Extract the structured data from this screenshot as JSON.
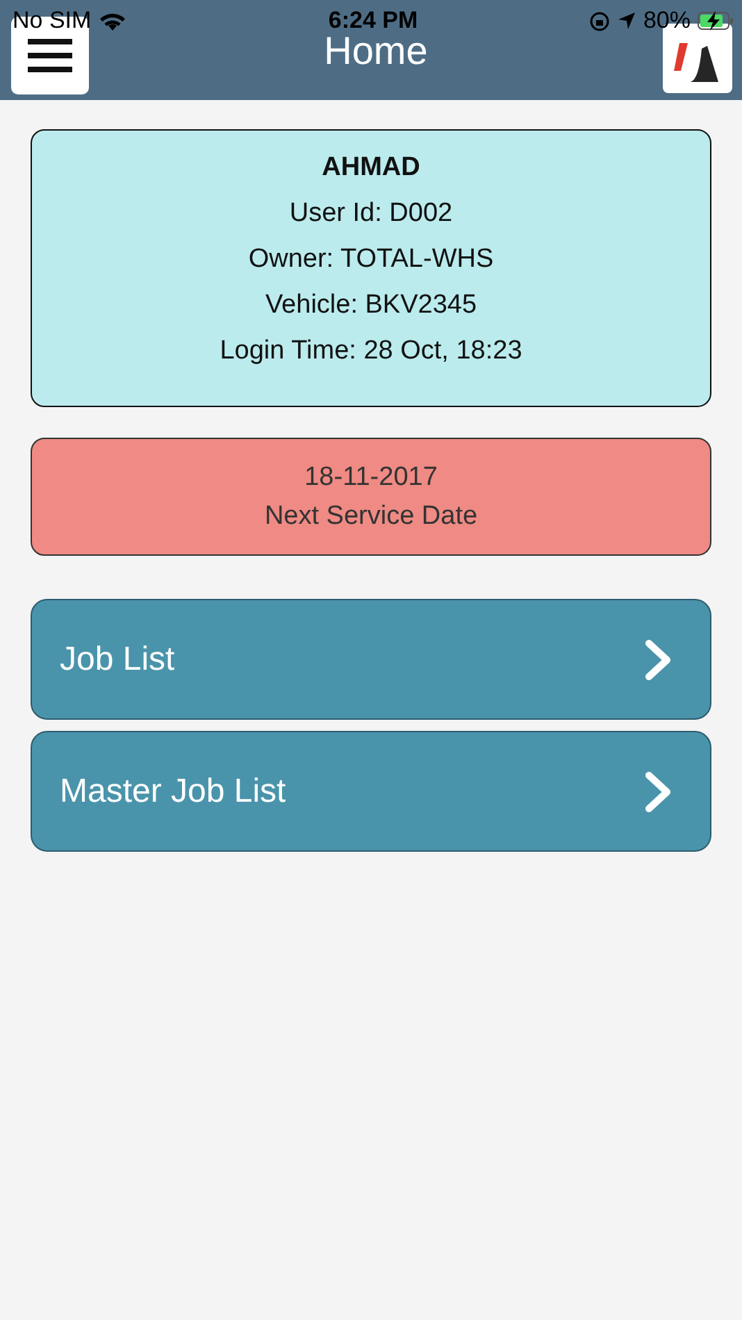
{
  "status_bar": {
    "carrier": "No SIM",
    "time": "6:24 PM",
    "battery": "80%"
  },
  "header": {
    "title": "Home"
  },
  "user_card": {
    "name": "AHMAD",
    "lines": [
      "User Id: D002",
      "Owner: TOTAL-WHS",
      "Vehicle: BKV2345",
      "Login Time: 28 Oct, 18:23"
    ]
  },
  "service_card": {
    "date": "18-11-2017",
    "label": "Next Service Date"
  },
  "menu": [
    {
      "label": "Job List"
    },
    {
      "label": "Master Job List"
    }
  ]
}
